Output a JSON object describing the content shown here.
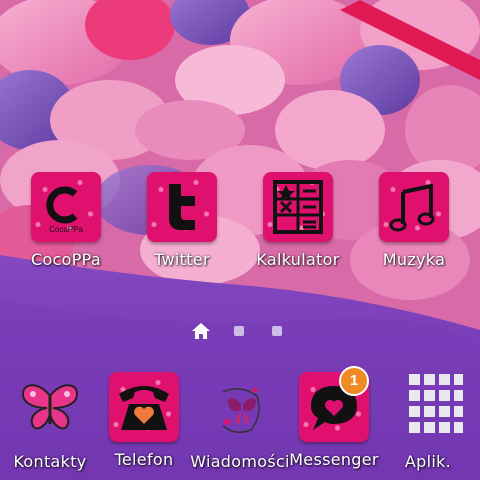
{
  "home_row": [
    {
      "label": "CocoPPa",
      "icon": "cocoppa-icon",
      "logo_text": "CocoPPa"
    },
    {
      "label": "Twitter",
      "icon": "twitter-icon",
      "logo_text": "t"
    },
    {
      "label": "Kalkulator",
      "icon": "calculator-icon"
    },
    {
      "label": "Muzyka",
      "icon": "music-note-icon"
    }
  ],
  "page_indicator": {
    "pages": 3,
    "current": 0,
    "home_icon": "home-icon"
  },
  "dock": [
    {
      "label": "Kontakty",
      "icon": "butterfly-icon"
    },
    {
      "label": "Telefon",
      "icon": "telephone-heart-icon"
    },
    {
      "label": "Wiadomości",
      "icon": "fairy-butterfly-icon"
    },
    {
      "label": "Messenger",
      "icon": "speech-bubble-heart-icon",
      "badge": "1"
    },
    {
      "label": "Aplik.",
      "icon": "app-grid-icon"
    }
  ],
  "colors": {
    "icon_bg": "#e0106e",
    "wallpaper_top": "#e68ab8",
    "wallpaper_bottom": "#7a3fb0",
    "badge": "#f08a24"
  }
}
